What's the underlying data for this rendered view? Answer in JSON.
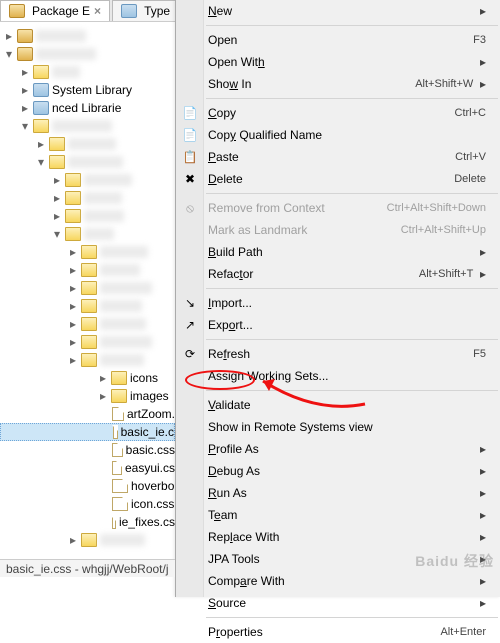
{
  "tabs": [
    {
      "label": "Package E",
      "active": true
    },
    {
      "label": "Type",
      "active": false
    }
  ],
  "tree": {
    "lib1": "System Library",
    "lib2": "nced Librarie",
    "folders": {
      "icons": "icons",
      "images": "images"
    },
    "files": {
      "artZoom": "artZoom.",
      "basic_ie": "basic_ie.c",
      "basic": "basic.css",
      "easyui": "easyui.cs",
      "hoverbox": "hoverbo",
      "icon": "icon.css",
      "ie_fixes": "ie_fixes.cs"
    }
  },
  "menu": {
    "new": "New",
    "open": "Open",
    "open_sc": "F3",
    "open_with": "Open With",
    "show_in": "Show In",
    "show_in_sc": "Alt+Shift+W",
    "copy": "Copy",
    "copy_sc": "Ctrl+C",
    "copy_qn": "Copy Qualified Name",
    "paste": "Paste",
    "paste_sc": "Ctrl+V",
    "delete": "Delete",
    "delete_sc": "Delete",
    "remove_ctx": "Remove from Context",
    "remove_ctx_sc": "Ctrl+Alt+Shift+Down",
    "mark_lm": "Mark as Landmark",
    "mark_lm_sc": "Ctrl+Alt+Shift+Up",
    "build_path": "Build Path",
    "refactor": "Refactor",
    "refactor_sc": "Alt+Shift+T",
    "import": "Import...",
    "export": "Export...",
    "refresh": "Refresh",
    "refresh_sc": "F5",
    "assign_ws": "Assign Working Sets...",
    "validate": "Validate",
    "show_remote": "Show in Remote Systems view",
    "profile_as": "Profile As",
    "debug_as": "Debug As",
    "run_as": "Run As",
    "team": "Team",
    "replace_with": "Replace With",
    "jpa_tools": "JPA Tools",
    "compare_with": "Compare With",
    "source": "Source",
    "properties": "Properties",
    "properties_sc": "Alt+Enter"
  },
  "status": "basic_ie.css - whgjj/WebRoot/j",
  "watermark": "Baidu 经验"
}
